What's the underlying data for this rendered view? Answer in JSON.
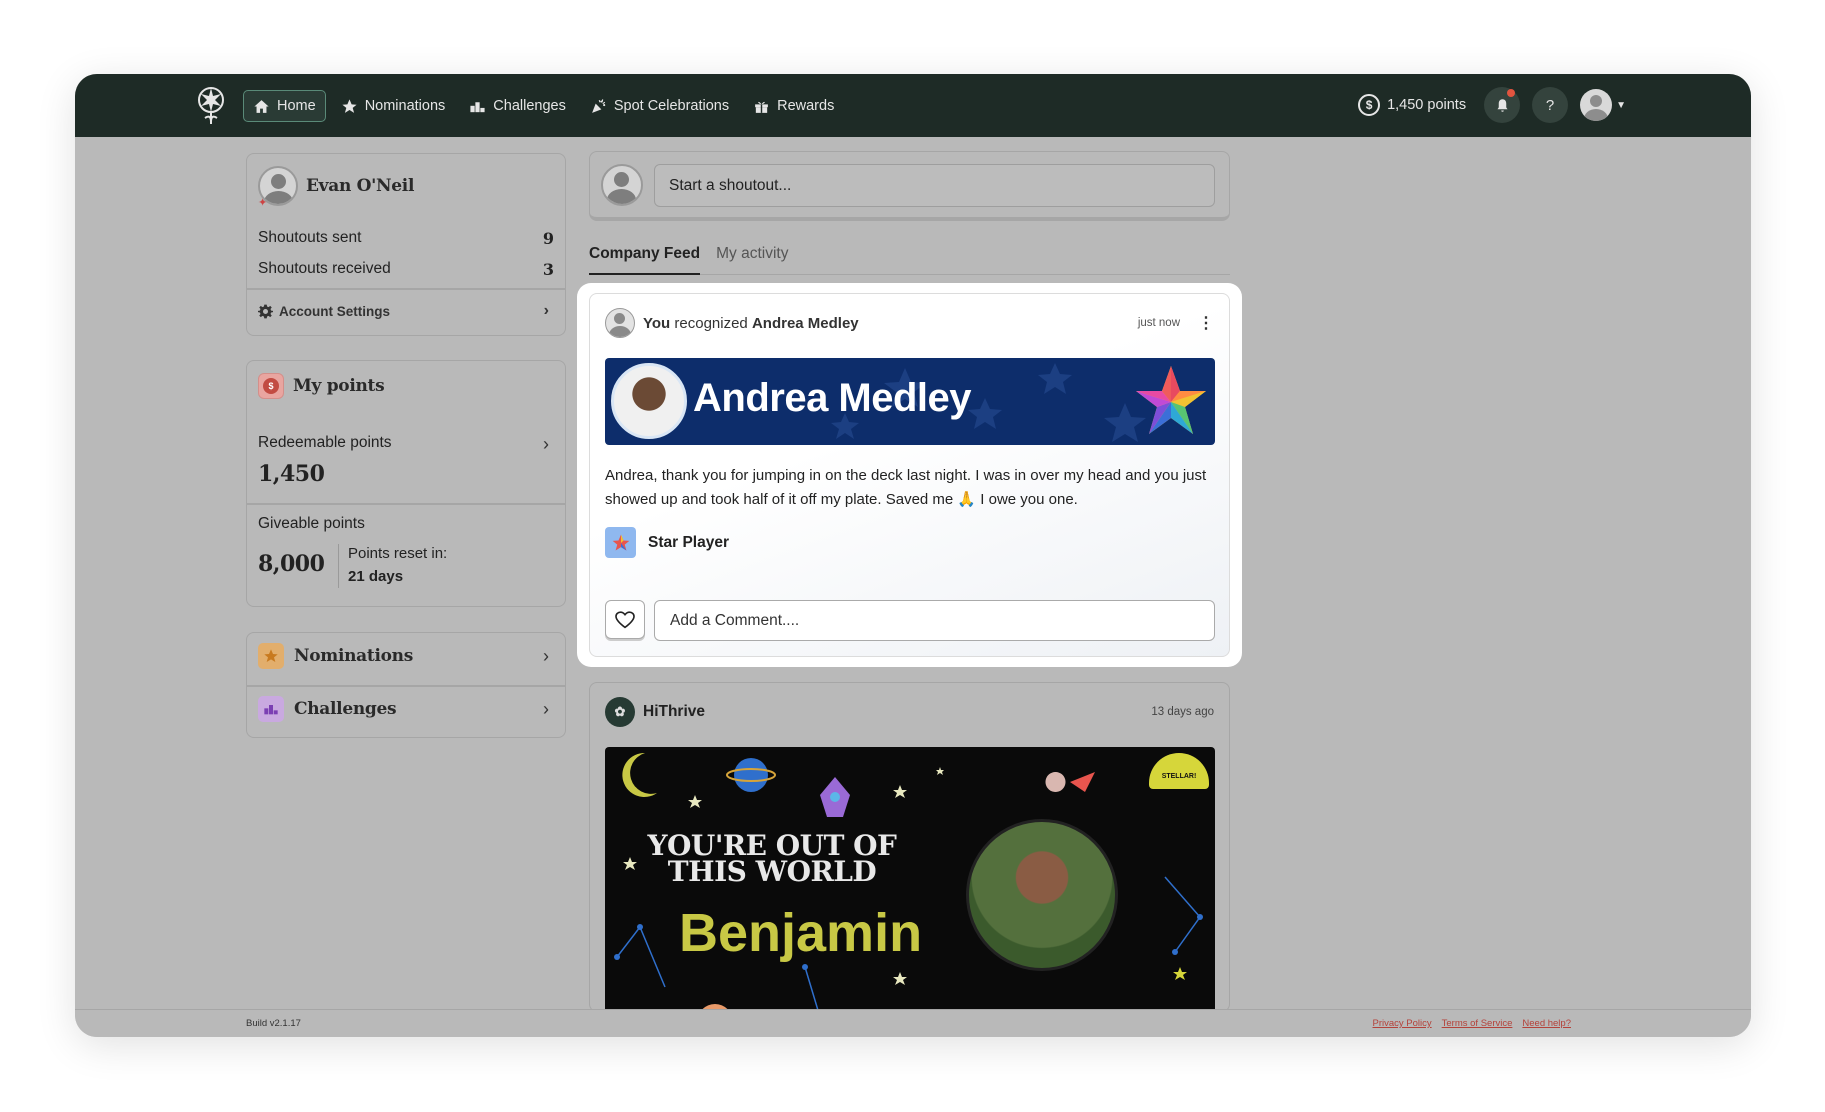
{
  "nav": {
    "items": [
      {
        "label": "Home",
        "icon": "home-icon"
      },
      {
        "label": "Nominations",
        "icon": "star-icon"
      },
      {
        "label": "Challenges",
        "icon": "podium-icon"
      },
      {
        "label": "Spot Celebrations",
        "icon": "confetti-icon"
      },
      {
        "label": "Rewards",
        "icon": "gift-icon"
      }
    ],
    "points": "1,450 points",
    "help": "?"
  },
  "profile": {
    "name": "Evan O'Neil",
    "shoutouts_sent_label": "Shoutouts sent",
    "shoutouts_sent": "9",
    "shoutouts_received_label": "Shoutouts received",
    "shoutouts_received": "3",
    "account_settings": "Account Settings"
  },
  "points_card": {
    "title": "My points",
    "redeemable_label": "Redeemable points",
    "redeemable_value": "1,450",
    "giveable_label": "Giveable points",
    "giveable_value": "8,000",
    "reset_label": "Points reset in:",
    "reset_value": "21 days"
  },
  "links": {
    "nominations": "Nominations",
    "challenges": "Challenges"
  },
  "shoutout": {
    "placeholder": "Start a shoutout..."
  },
  "tabs": [
    {
      "label": "Company Feed",
      "active": true
    },
    {
      "label": "My activity",
      "active": false
    }
  ],
  "post1": {
    "actor": "You",
    "verb": "recognized",
    "recipient": "Andrea Medley",
    "time": "just now",
    "banner_name": "Andrea Medley",
    "message": "Andrea, thank you for jumping in on the deck last night. I was in over my head and you just showed up and took half of it off my plate. Saved me 🙏 I owe you one.",
    "badge": "Star Player",
    "comment_placeholder": "Add a Comment...."
  },
  "post2": {
    "author": "HiThrive",
    "time": "13 days ago",
    "banner_title": "YOU'RE OUT OF THIS WORLD",
    "banner_name": "Benjamin",
    "sticker": "STELLAR!"
  },
  "footer": {
    "build": "Build v2.1.17",
    "privacy": "Privacy Policy",
    "terms": "Terms of Service",
    "help": "Need help?"
  },
  "colors": {
    "topbar": "#1e2b26",
    "overlay": "#b9b9b9",
    "banner_blue": "#0d2d6b",
    "link_red": "#b4423a"
  }
}
